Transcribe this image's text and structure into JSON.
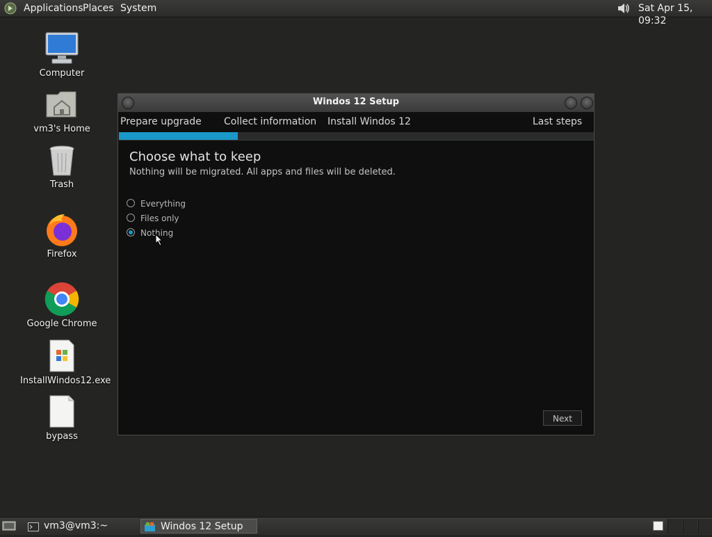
{
  "top_panel": {
    "menus": [
      "Applications",
      "Places",
      "System"
    ],
    "clock": "Sat Apr 15, 09:32",
    "icons": {
      "menu": "gnome-foot-icon",
      "volume": "volume-icon"
    }
  },
  "desktop": {
    "icons": [
      {
        "label": "Computer",
        "icon": "computer-icon"
      },
      {
        "label": "vm3's Home",
        "icon": "home-folder-icon"
      },
      {
        "label": "Trash",
        "icon": "trash-icon"
      },
      {
        "label": "Firefox",
        "icon": "firefox-icon"
      },
      {
        "label": "Google Chrome",
        "icon": "chrome-icon"
      },
      {
        "label": "InstallWindos12.exe",
        "icon": "exe-file-icon"
      },
      {
        "label": "bypass",
        "icon": "file-icon"
      }
    ]
  },
  "window": {
    "title": "Windos 12 Setup",
    "steps": [
      "Prepare upgrade",
      "Collect information",
      "Install Windos 12",
      "Last steps"
    ],
    "progress_fraction": 0.25,
    "heading": "Choose what to keep",
    "subtext": "Nothing will be migrated. All apps and files will be deleted.",
    "options": [
      {
        "label": "Everything",
        "checked": false
      },
      {
        "label": "Files only",
        "checked": false
      },
      {
        "label": "Nothing",
        "checked": true
      }
    ],
    "next_label": "Next"
  },
  "bottom_panel": {
    "tasks": [
      {
        "label": "vm3@vm3:~",
        "icon": "terminal-icon",
        "active": false
      },
      {
        "label": "Windos 12 Setup",
        "icon": "setup-app-icon",
        "active": true
      }
    ]
  },
  "colors": {
    "accent": "#1a98c9",
    "desktop_bg": "#242522",
    "window_bg": "#0f0f0f"
  }
}
